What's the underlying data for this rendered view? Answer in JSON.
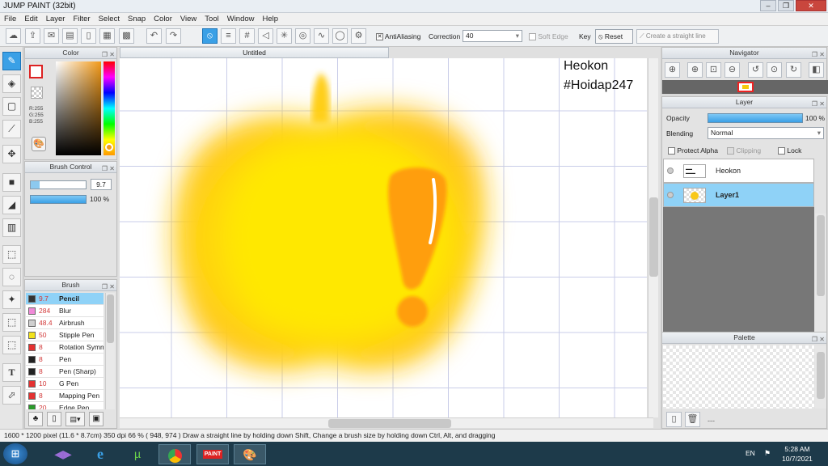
{
  "window": {
    "title": "JUMP PAINT (32bit)",
    "minimize": "–",
    "restore": "❐",
    "close": "✕"
  },
  "menu": [
    "File",
    "Edit",
    "Layer",
    "Filter",
    "Select",
    "Snap",
    "Color",
    "View",
    "Tool",
    "Window",
    "Help"
  ],
  "toolbar": {
    "antialiasing_label": "AntiAliasing",
    "correction_label": "Correction",
    "correction_value": "40",
    "soft_edge_label": "Soft Edge",
    "key_label": "Key",
    "reset_label": "Reset",
    "straight_line_label": "Create a straight line"
  },
  "color_panel": {
    "title": "Color",
    "r": "R:255",
    "g": "G:255",
    "b": "B:255"
  },
  "brush_control": {
    "title": "Brush Control",
    "size": "9.7",
    "opacity": "100 %"
  },
  "brush_panel": {
    "title": "Brush",
    "items": [
      {
        "size": "9.7",
        "name": "Pencil",
        "color": "#333333",
        "selected": true
      },
      {
        "size": "284",
        "name": "Blur",
        "color": "#f08ad8",
        "selected": false
      },
      {
        "size": "48.4",
        "name": "Airbrush",
        "color": "#cfcfcf",
        "selected": false
      },
      {
        "size": "50",
        "name": "Stipple Pen",
        "color": "#f2e21c",
        "selected": false
      },
      {
        "size": "8",
        "name": "Rotation Symm",
        "color": "#e53131",
        "selected": false
      },
      {
        "size": "8",
        "name": "Pen",
        "color": "#222222",
        "selected": false
      },
      {
        "size": "8",
        "name": "Pen (Sharp)",
        "color": "#222222",
        "selected": false
      },
      {
        "size": "10",
        "name": "G Pen",
        "color": "#e53131",
        "selected": false
      },
      {
        "size": "8",
        "name": "Mapping Pen",
        "color": "#e53131",
        "selected": false
      },
      {
        "size": "20",
        "name": "Edge Pen",
        "color": "#2a9a2a",
        "selected": false
      }
    ]
  },
  "document": {
    "tab_title": "Untitled",
    "text_line1": "Heokon",
    "text_line2": "#Hoidap247"
  },
  "navigator": {
    "title": "Navigator"
  },
  "layer_panel": {
    "title": "Layer",
    "opacity_label": "Opacity",
    "opacity_value": "100 %",
    "blending_label": "Blending",
    "blending_value": "Normal",
    "protect_alpha": "Protect Alpha",
    "clipping": "Clipping",
    "lock": "Lock",
    "layers": [
      {
        "name": "Heokon",
        "selected": false
      },
      {
        "name": "Layer1",
        "selected": true
      }
    ]
  },
  "palette": {
    "title": "Palette",
    "dashes": "---"
  },
  "status": {
    "text": "1600 * 1200 pixel  (11.6 * 8.7cm)  350 dpi  66 %  ( 948, 974 )  Draw a straight line by holding down Shift, Change a brush size by holding down Ctrl, Alt, and dragging"
  },
  "taskbar": {
    "lang": "EN",
    "time": "5:28 AM",
    "date": "10/7/2021"
  },
  "colors": {
    "accent": "#3aa0e6",
    "selection": "#8fd2f7",
    "apple": "#ffe21a",
    "exclamation": "#ff9e0d"
  }
}
